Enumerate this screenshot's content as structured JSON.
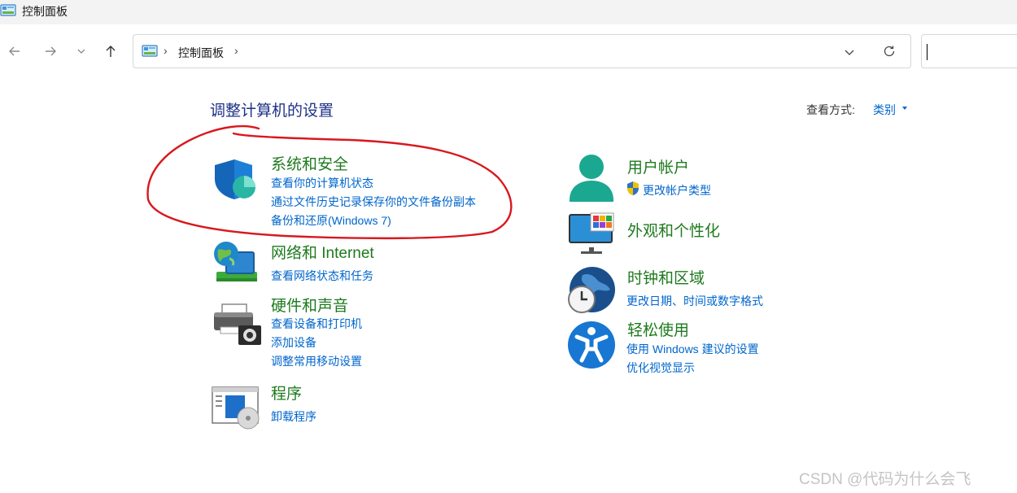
{
  "window": {
    "title": "控制面板",
    "app_icon": "control-panel-icon"
  },
  "address_bar": {
    "crumb": "控制面板",
    "separator": "›"
  },
  "search": {
    "value": ""
  },
  "main": {
    "heading": "调整计算机的设置",
    "view_by_label": "查看方式:",
    "view_by_value": "类别"
  },
  "categories": {
    "system_security": {
      "title": "系统和安全",
      "icon": "shield-icon",
      "links": [
        "查看你的计算机状态",
        "通过文件历史记录保存你的文件备份副本",
        "备份和还原(Windows 7)"
      ]
    },
    "network": {
      "title": "网络和 Internet",
      "icon": "network-globe-icon",
      "links": [
        "查看网络状态和任务"
      ]
    },
    "hardware": {
      "title": "硬件和声音",
      "icon": "printer-icon",
      "links": [
        "查看设备和打印机",
        "添加设备",
        "调整常用移动设置"
      ]
    },
    "programs": {
      "title": "程序",
      "icon": "programs-icon",
      "links": [
        "卸载程序"
      ]
    },
    "user_accounts": {
      "title": "用户帐户",
      "icon": "user-icon",
      "links": [
        "更改帐户类型"
      ]
    },
    "appearance": {
      "title": "外观和个性化",
      "icon": "monitor-icon",
      "links": []
    },
    "clock_region": {
      "title": "时钟和区域",
      "icon": "clock-globe-icon",
      "links": [
        "更改日期、时间或数字格式"
      ]
    },
    "ease_of_access": {
      "title": "轻松使用",
      "icon": "accessibility-icon",
      "links": [
        "使用 Windows 建议的设置",
        "优化视觉显示"
      ]
    }
  },
  "watermark": "CSDN @代码为什么会飞",
  "colors": {
    "category_title": "#1e7a1e",
    "link": "#0066cc",
    "heading": "#1e3287",
    "annotation": "#d8181e"
  }
}
